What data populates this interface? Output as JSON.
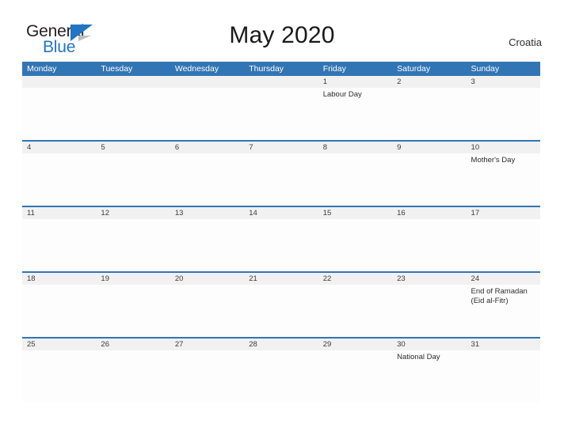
{
  "brand": {
    "name_part1": "General",
    "name_part2": "Blue",
    "flag_icon": "blue-triangle-flag-icon",
    "color_dark": "#231f20",
    "color_blue": "#2175c4"
  },
  "header": {
    "title": "May 2020",
    "region": "Croatia"
  },
  "theme": {
    "header_blue": "#3275b4",
    "date_strip_gray": "#f1f1f1",
    "cell_white": "#fdfdfd",
    "text_dark": "#2b2b2b"
  },
  "calendar": {
    "weekdays": [
      "Monday",
      "Tuesday",
      "Wednesday",
      "Thursday",
      "Friday",
      "Saturday",
      "Sunday"
    ],
    "weeks": [
      {
        "dates": [
          "",
          "",
          "",
          "",
          "1",
          "2",
          "3"
        ],
        "events": [
          [],
          [],
          [],
          [],
          [
            "Labour Day"
          ],
          [],
          []
        ]
      },
      {
        "dates": [
          "4",
          "5",
          "6",
          "7",
          "8",
          "9",
          "10"
        ],
        "events": [
          [],
          [],
          [],
          [],
          [],
          [],
          [
            "Mother's Day"
          ]
        ]
      },
      {
        "dates": [
          "11",
          "12",
          "13",
          "14",
          "15",
          "16",
          "17"
        ],
        "events": [
          [],
          [],
          [],
          [],
          [],
          [],
          []
        ]
      },
      {
        "dates": [
          "18",
          "19",
          "20",
          "21",
          "22",
          "23",
          "24"
        ],
        "events": [
          [],
          [],
          [],
          [],
          [],
          [],
          [
            "End of Ramadan",
            "(Eid al-Fitr)"
          ]
        ]
      },
      {
        "dates": [
          "25",
          "26",
          "27",
          "28",
          "29",
          "30",
          "31"
        ],
        "events": [
          [],
          [],
          [],
          [],
          [],
          [
            "National Day"
          ],
          []
        ]
      }
    ]
  }
}
